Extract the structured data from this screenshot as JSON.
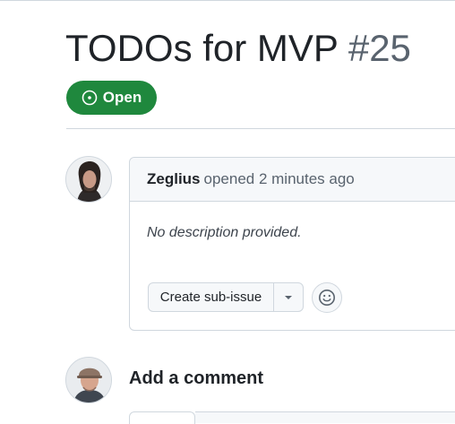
{
  "issue": {
    "title": "TODOs for MVP",
    "number": "#25",
    "state": "Open",
    "state_icon": "issue-opened-icon"
  },
  "colors": {
    "open_green": "#1f883d",
    "muted_text": "#59636e",
    "border": "#d0d7de",
    "header_bg": "#f6f8fa"
  },
  "comment": {
    "author": "Zeglius",
    "action_text": "opened 2 minutes ago",
    "body": "No description provided.",
    "sub_issue_label": "Create sub-issue",
    "dropdown_icon": "triangle-down-icon",
    "reaction_icon": "smiley-icon"
  },
  "new_comment": {
    "heading": "Add a comment"
  }
}
